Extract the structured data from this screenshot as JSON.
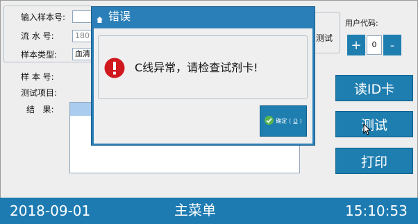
{
  "form": {
    "sample_input_label": "输入样本号:",
    "serial_label": "流 水 号:",
    "serial_value": "180",
    "sample_type_label": "样本类型:",
    "sample_type_value": "血清",
    "test_label_partial": "测试",
    "user_code_label": "用户代码:",
    "user_code_value": "0",
    "minus_label": "-",
    "plus_label": "+"
  },
  "result": {
    "sample_no_label": "样 本 号:",
    "test_item_label": "测试项目:",
    "result_label": "结   果:"
  },
  "buttons": {
    "read_id_card": "读ID卡",
    "test": "测试",
    "print": "打印"
  },
  "dialog": {
    "title": "错误",
    "message": "C线异常，请检查试剂卡!",
    "ok_label": "确定",
    "ok_hotkey": "O"
  },
  "statusbar": {
    "date": "2018-09-01",
    "main_menu": "主菜单",
    "time": "15:10:53"
  },
  "colors": {
    "accent": "#1f7eb0",
    "error": "#d0191f"
  },
  "icons": [
    "title-bar-icon",
    "error-icon",
    "check-icon",
    "cursor-icon"
  ]
}
